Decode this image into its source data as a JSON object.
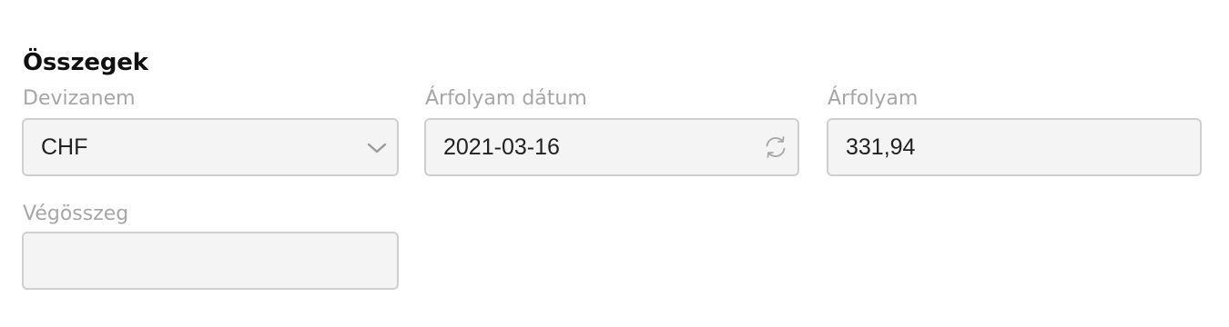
{
  "section": {
    "title": "Összegek"
  },
  "fields": {
    "currency": {
      "label": "Devizanem",
      "value": "CHF",
      "icon": "chevron-down-icon"
    },
    "rate_date": {
      "label": "Árfolyam dátum",
      "value": "2021-03-16",
      "icon": "refresh-icon"
    },
    "rate": {
      "label": "Árfolyam",
      "value": "331,94"
    },
    "total": {
      "label": "Végösszeg",
      "value": ""
    }
  },
  "colors": {
    "label": "#a6a6a6",
    "field_background": "#f4f4f4",
    "field_border": "#cfcfcf",
    "value_text": "#222222",
    "title_text": "#111111"
  }
}
